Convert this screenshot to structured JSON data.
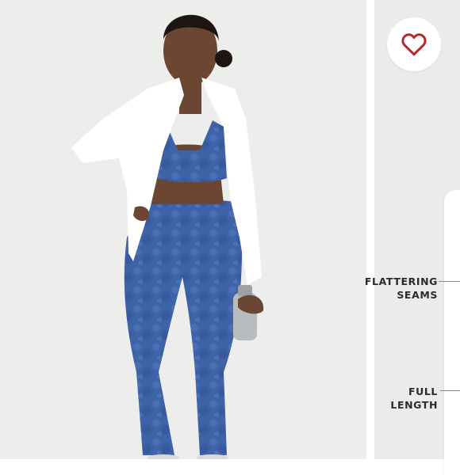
{
  "colors": {
    "accent_heart": "#b5282e",
    "legging_blue": "#3f63a8",
    "jacket_white": "#ffffff",
    "background": "#ededec"
  },
  "icons": {
    "favorite": "heart-outline-icon"
  },
  "callouts": [
    {
      "line1": "FLATTERING",
      "line2": "SEAMS"
    },
    {
      "line1": "FULL",
      "line2": "LENGTH"
    }
  ]
}
